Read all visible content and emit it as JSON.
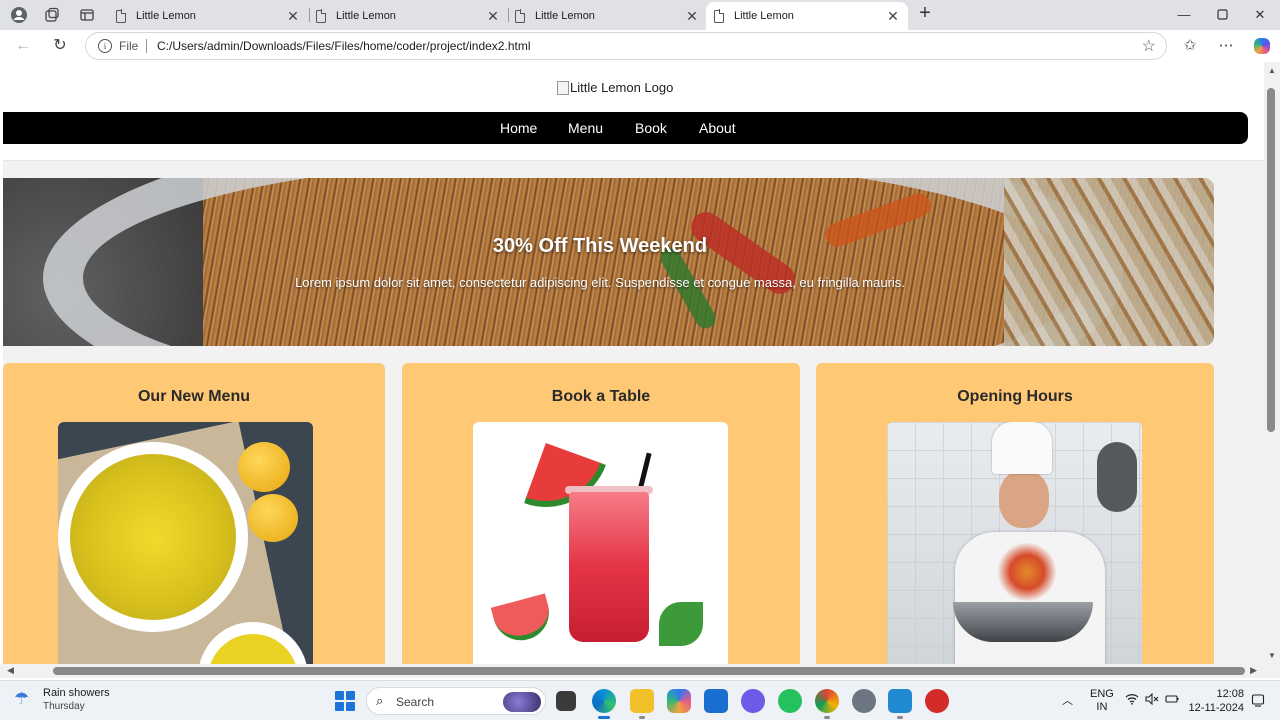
{
  "browser": {
    "tabs": [
      {
        "title": "Little Lemon"
      },
      {
        "title": "Little Lemon"
      },
      {
        "title": "Little Lemon"
      },
      {
        "title": "Little Lemon",
        "active": true
      }
    ],
    "address": {
      "scheme_label": "File",
      "url": "C:/Users/admin/Downloads/Files/Files/home/coder/project/index2.html"
    }
  },
  "site": {
    "logo_alt": "Little Lemon Logo",
    "nav": [
      "Home",
      "Menu",
      "Book",
      "About"
    ],
    "hero": {
      "title": "30% Off This Weekend",
      "text": "Lorem ipsum dolor sit amet, consectetur adipiscing elit. Suspendisse et congue massa, eu fringilla mauris."
    },
    "cards": [
      {
        "title": "Our New Menu",
        "image": "rice-bowl-with-lemons"
      },
      {
        "title": "Book a Table",
        "image": "watermelon-drink"
      },
      {
        "title": "Opening Hours",
        "image": "chef-tossing-pan"
      }
    ],
    "colors": {
      "nav_bg": "#000000",
      "card_bg": "#ffc874",
      "page_bg": "#f2f2f2"
    }
  },
  "taskbar": {
    "weather_title": "Rain showers",
    "weather_sub": "Thursday",
    "search_placeholder": "Search",
    "lang_top": "ENG",
    "lang_bottom": "IN",
    "time": "12:08",
    "date": "12-11-2024"
  }
}
